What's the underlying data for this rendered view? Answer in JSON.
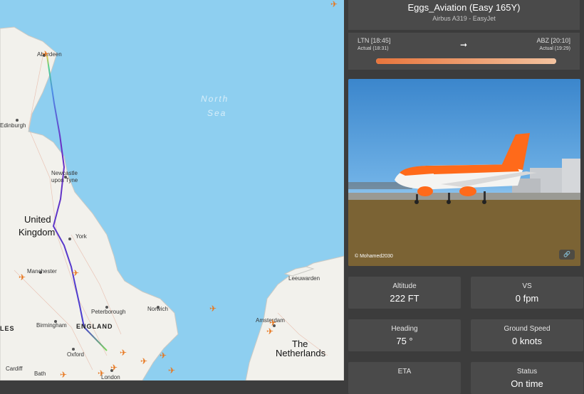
{
  "map": {
    "sea_label_1": "North",
    "sea_label_2": "Sea",
    "countries": {
      "uk_line1": "United",
      "uk_line2": "Kingdom",
      "england": "ENGLAND",
      "nl_line1": "The",
      "nl_line2": "Netherlands",
      "wales_partial": "LES"
    },
    "cities": {
      "aberdeen": "Aberdeen",
      "edinburgh": "Edinburgh",
      "newcastle_1": "Newcastle",
      "newcastle_2": "upon Tyne",
      "york": "York",
      "manchester": "Manchester",
      "peterborough": "Peterborough",
      "norwich": "Norwich",
      "birmingham": "Birmingham",
      "oxford": "Oxford",
      "cardiff": "Cardiff",
      "bath": "Bath",
      "london": "London",
      "amsterdam": "Amsterdam",
      "leeuwarden": "Leeuwarden"
    }
  },
  "flight": {
    "title": "Eggs_Aviation (Easy 165Y)",
    "subtitle": "Airbus A319 - EasyJet",
    "origin": "LTN [18:45]",
    "origin_actual": "Actual (18:31)",
    "destination": "ABZ [20:10]",
    "destination_actual": "Actual (19:29)",
    "arrow": "➞",
    "progress_fraction": 1.0
  },
  "photo": {
    "credit": "© Mohamed2030",
    "link_icon": "link-icon",
    "link_glyph": "🔗"
  },
  "stats": [
    {
      "label": "Altitude",
      "value": "222 FT"
    },
    {
      "label": "VS",
      "value": "0 fpm"
    },
    {
      "label": "Heading",
      "value": "75 °"
    },
    {
      "label": "Ground Speed",
      "value": "0 knots"
    },
    {
      "label": "ETA",
      "value": ""
    },
    {
      "label": "Status",
      "value": "On time"
    }
  ],
  "colors": {
    "accent": "#e8753c",
    "panel_bg": "#3c3c3c",
    "card_bg": "#4a4a4a",
    "sea": "#8ecff0",
    "land": "#f2f1ec",
    "route_purple": "#6b2fc4"
  }
}
